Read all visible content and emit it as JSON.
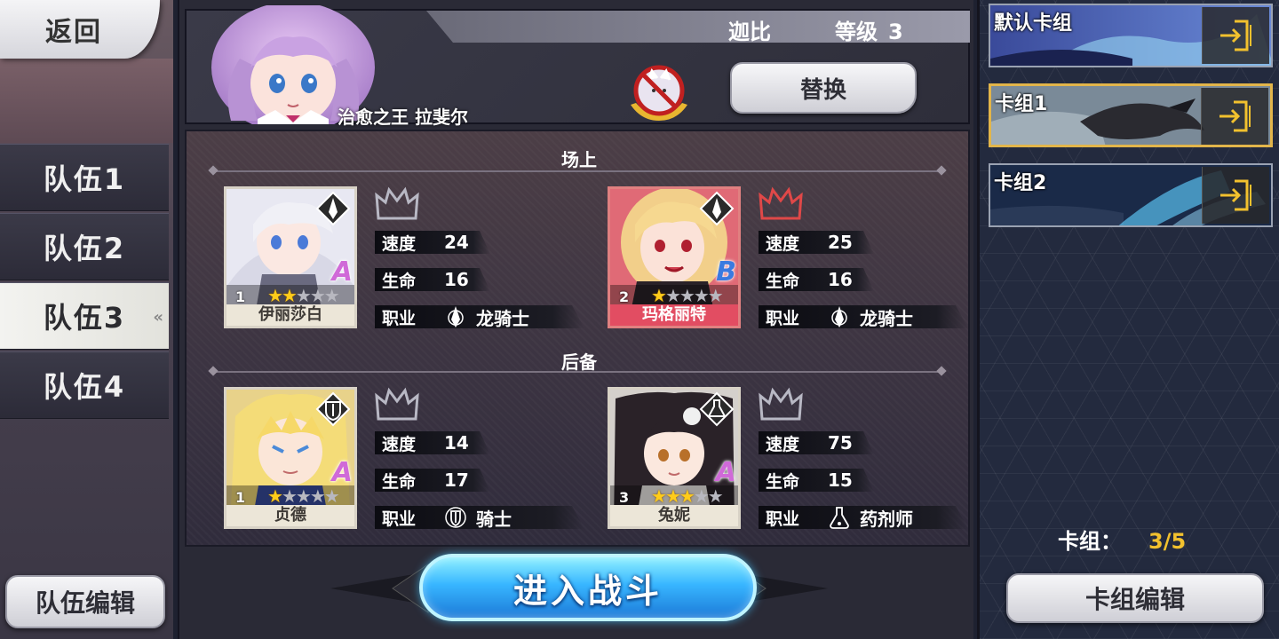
{
  "nav": {
    "back_label": "返回"
  },
  "teams": [
    {
      "label": "队伍1",
      "active": false
    },
    {
      "label": "队伍2",
      "active": false
    },
    {
      "label": "队伍3",
      "active": true
    },
    {
      "label": "队伍4",
      "active": false
    }
  ],
  "team_edit_label": "队伍编辑",
  "header": {
    "player_name": "迦比",
    "level_label": "等级",
    "level_value": "3",
    "hero_title": "治愈之王 拉斐尔",
    "replace_label": "替换"
  },
  "sections": {
    "field": "场上",
    "reserve": "后备"
  },
  "stat_labels": {
    "speed": "速度",
    "hp": "生命",
    "job": "职业"
  },
  "units": [
    {
      "name": "伊丽莎白",
      "cost": "1",
      "stars": 2,
      "rank": "A",
      "speed": "24",
      "hp": "16",
      "job": "龙骑士",
      "job_icon": "lance-icon",
      "card_color": "#c9c3b7"
    },
    {
      "name": "玛格丽特",
      "cost": "2",
      "stars": 1,
      "rank": "B",
      "speed": "25",
      "hp": "16",
      "job": "龙骑士",
      "job_icon": "lance-icon",
      "card_color": "#d45a68"
    },
    {
      "name": "贞德",
      "cost": "1",
      "stars": 1,
      "rank": "A",
      "speed": "14",
      "hp": "17",
      "job": "骑士",
      "job_icon": "shield-icon",
      "card_color": "#c9c3b7"
    },
    {
      "name": "兔妮",
      "cost": "3",
      "stars": 3,
      "rank": "A",
      "speed": "75",
      "hp": "15",
      "job": "药剂师",
      "job_icon": "flask-icon",
      "card_color": "#c9c3b7"
    }
  ],
  "fight_label": "进入战斗",
  "decks": [
    {
      "label": "默认卡组",
      "active": false
    },
    {
      "label": "卡组1",
      "active": true
    },
    {
      "label": "卡组2",
      "active": false
    }
  ],
  "deck_count_label": "卡组：",
  "deck_count_value": "3/5",
  "deck_edit_label": "卡组编辑",
  "colors": {
    "accent_gold": "#f2c12e",
    "fight_blue": "#38b6ff",
    "active_border": "#e2b54a"
  }
}
